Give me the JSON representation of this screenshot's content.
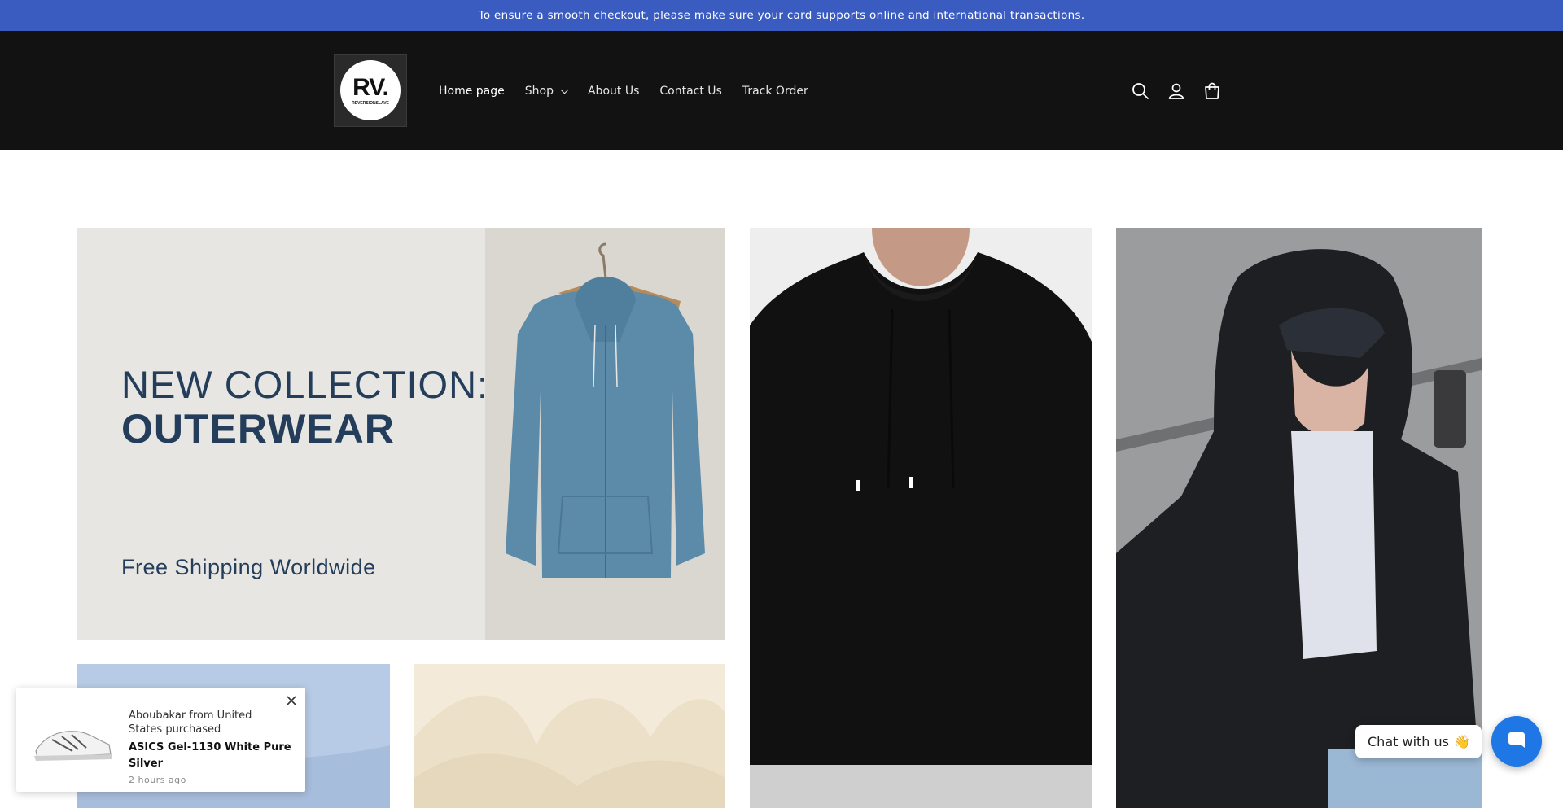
{
  "announcement": {
    "text": "To ensure a smooth checkout, please make sure your card supports online and international transactions."
  },
  "header": {
    "logo": {
      "mark": "RV.",
      "tagline": "REVERSIONSLAVE"
    },
    "nav": [
      {
        "label": "Home page",
        "active": true
      },
      {
        "label": "Shop",
        "has_dropdown": true
      },
      {
        "label": "About Us"
      },
      {
        "label": "Contact Us"
      },
      {
        "label": "Track Order"
      }
    ],
    "icons": [
      "search-icon",
      "account-icon",
      "cart-icon"
    ]
  },
  "banner": {
    "line1": "NEW COLLECTION:",
    "line2": "OUTERWEAR",
    "line3": "Free Shipping Worldwide"
  },
  "purchase_popup": {
    "who": "Aboubakar from United States purchased",
    "product": "ASICS Gel-1130 White Pure Silver",
    "time": "2 hours ago"
  },
  "chat": {
    "label": "Chat with us",
    "emoji": "👋"
  },
  "colors": {
    "announcement_bg": "#3a5bbf",
    "header_bg": "#121212",
    "banner_text": "#233d5a",
    "chat_button": "#1f77e6"
  }
}
